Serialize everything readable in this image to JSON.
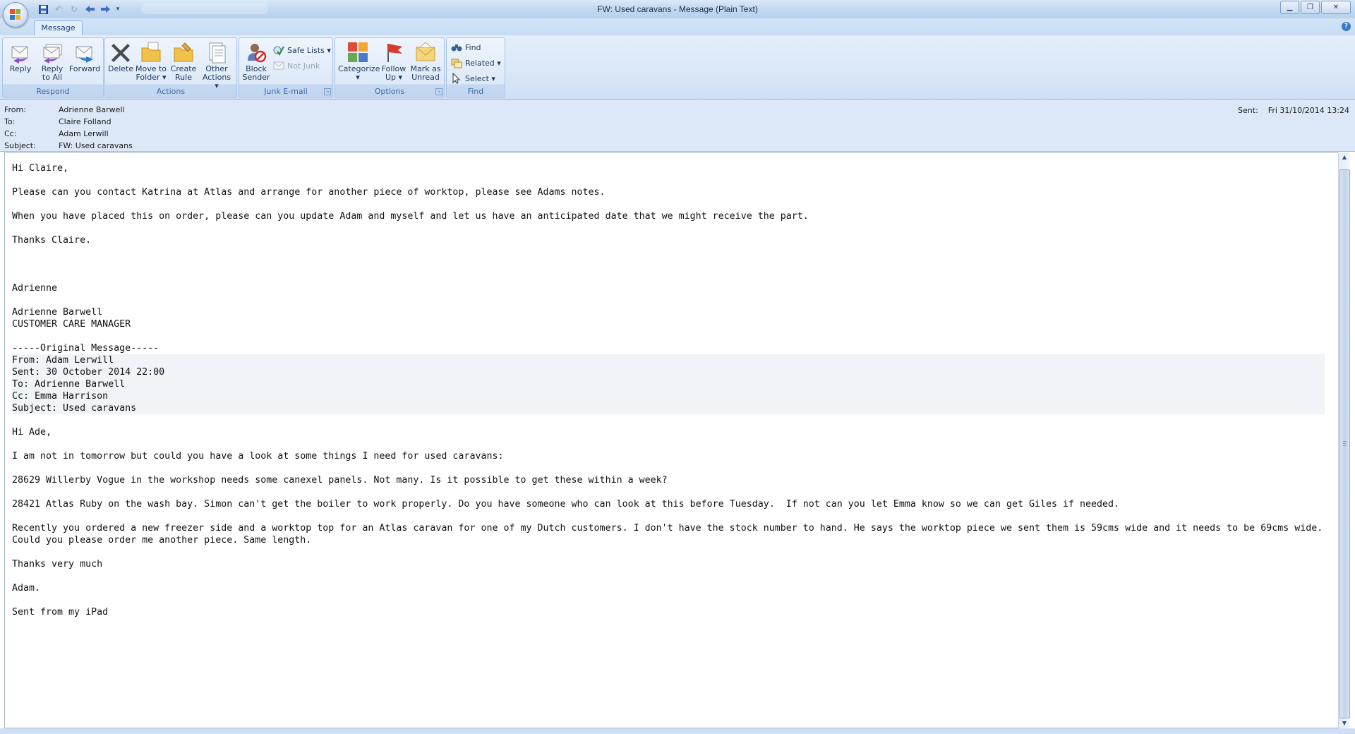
{
  "window": {
    "title": "FW: Used caravans - Message (Plain Text)",
    "controls": [
      "minimize",
      "maximize",
      "close"
    ]
  },
  "quick_access": {
    "items": [
      "save-icon",
      "undo-icon",
      "redo-icon",
      "previous-item-icon",
      "next-item-icon",
      "customize-icon"
    ]
  },
  "ribbon": {
    "tabs": [
      {
        "label": "Message",
        "active": true
      }
    ],
    "groups": {
      "respond": {
        "label": "Respond",
        "reply": "Reply",
        "reply_all": "Reply\nto All",
        "forward": "Forward"
      },
      "actions": {
        "label": "Actions",
        "delete": "Delete",
        "move_to_folder": "Move to\nFolder ▾",
        "create_rule": "Create\nRule",
        "other_actions": "Other\nActions ▾"
      },
      "junk": {
        "label": "Junk E-mail",
        "block_sender": "Block\nSender",
        "safe_lists": "Safe Lists ▾",
        "not_junk": "Not Junk"
      },
      "options": {
        "label": "Options",
        "categorize": "Categorize\n▾",
        "follow_up": "Follow\nUp ▾",
        "mark_unread": "Mark as\nUnread"
      },
      "find": {
        "label": "Find",
        "find": "Find",
        "related": "Related ▾",
        "select": "Select ▾"
      }
    }
  },
  "header": {
    "from_label": "From:",
    "from": "Adrienne Barwell",
    "to_label": "To:",
    "to": "Claire Folland",
    "cc_label": "Cc:",
    "cc": "Adam Lerwill",
    "subject_label": "Subject:",
    "subject": "FW: Used caravans",
    "sent_label": "Sent:",
    "sent": "Fri 31/10/2014 13:24"
  },
  "body": {
    "lines": [
      "Hi Claire,",
      "",
      "Please can you contact Katrina at Atlas and arrange for another piece of worktop, please see Adams notes.",
      "",
      "When you have placed this on order, please can you update Adam and myself and let us have an anticipated date that we might receive the part.",
      "",
      "Thanks Claire.",
      "",
      "",
      "",
      "Adrienne",
      "",
      "Adrienne Barwell",
      "CUSTOMER CARE MANAGER",
      "",
      "-----Original Message-----",
      "From: Adam Lerwill",
      "Sent: 30 October 2014 22:00",
      "To: Adrienne Barwell",
      "Cc: Emma Harrison",
      "Subject: Used caravans",
      "",
      "Hi Ade,",
      "",
      "I am not in tomorrow but could you have a look at some things I need for used caravans:",
      "",
      "28629 Willerby Vogue in the workshop needs some canexel panels. Not many. Is it possible to get these within a week?",
      "",
      "28421 Atlas Ruby on the wash bay. Simon can't get the boiler to work properly. Do you have someone who can look at this before Tuesday.  If not can you let Emma know so we can get Giles if needed.",
      "",
      "Recently you ordered a new freezer side and a worktop top for an Atlas caravan for one of my Dutch customers. I don't have the stock number to hand. He says the worktop piece we sent them is 59cms wide and it needs to be 69cms wide.",
      "Could you please order me another piece. Same length.",
      "",
      "Thanks very much",
      "",
      "Adam.",
      "",
      "Sent from my iPad"
    ]
  }
}
